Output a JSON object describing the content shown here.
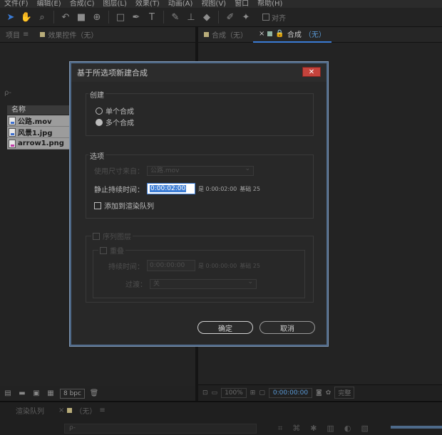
{
  "menu": [
    "文件(F)",
    "编辑(E)",
    "合成(C)",
    "图层(L)",
    "效果(T)",
    "动画(A)",
    "视图(V)",
    "窗口",
    "帮助(H)"
  ],
  "toolbar": {
    "tools": [
      "selection-tool-icon",
      "hand-tool-icon",
      "zoom-tool-icon",
      "rotate-tool-icon",
      "camera-tool-icon",
      "pan-behind-tool-icon",
      "mask-tool-icon",
      "pen-tool-icon",
      "text-tool-icon",
      "brush-tool-icon",
      "clone-stamp-tool-icon",
      "eraser-tool-icon",
      "roto-brush-tool-icon",
      "puppet-pin-tool-icon"
    ],
    "snap_label": "对齐"
  },
  "left_panel": {
    "tab_project": "项目",
    "tab_effects": "效果控件（无）",
    "search_hint": "ρ-",
    "column_name": "名称",
    "files": [
      {
        "name": "公路.mov",
        "type": "mov"
      },
      {
        "name": "风景1.jpg",
        "type": "jpg"
      },
      {
        "name": "arrow1.png",
        "type": "png"
      }
    ],
    "bpc": "8 bpc"
  },
  "right_panel": {
    "tab_comp_none": "合成（无）",
    "tab_comp_active_prefix": "合成",
    "tab_comp_active_value": "（无）",
    "footer": {
      "zoom": "100%",
      "timecode": "0:00:00:00",
      "quality": "完整"
    }
  },
  "bottom": {
    "tab_render_queue": "渲染队列",
    "tab_timeline": "（无）",
    "search_hint": "ρ-"
  },
  "dialog": {
    "title": "基于所选项新建合成",
    "close_symbol": "✕",
    "create_label": "创建",
    "radio_single": "单个合成",
    "radio_multiple": "多个合成",
    "options_label": "选项",
    "use_size_from": "使用尺寸来自：",
    "use_size_value": "公路.mov",
    "still_duration_label": "静止持续时间：",
    "still_duration_value": "0:00:02:00",
    "still_duration_info": "是 0:00:02:00",
    "still_duration_base": "基础 25",
    "add_render_queue": "添加到渲染队列",
    "sequence_layers": "序列图层",
    "overlap": "重叠",
    "duration_label": "持续时间：",
    "duration_value": "0:00:00:00",
    "duration_info": "是 0:00:00:00",
    "duration_base": "基础 25",
    "transition_label": "过渡：",
    "transition_value": "关",
    "ok_button": "确定",
    "cancel_button": "取消"
  }
}
